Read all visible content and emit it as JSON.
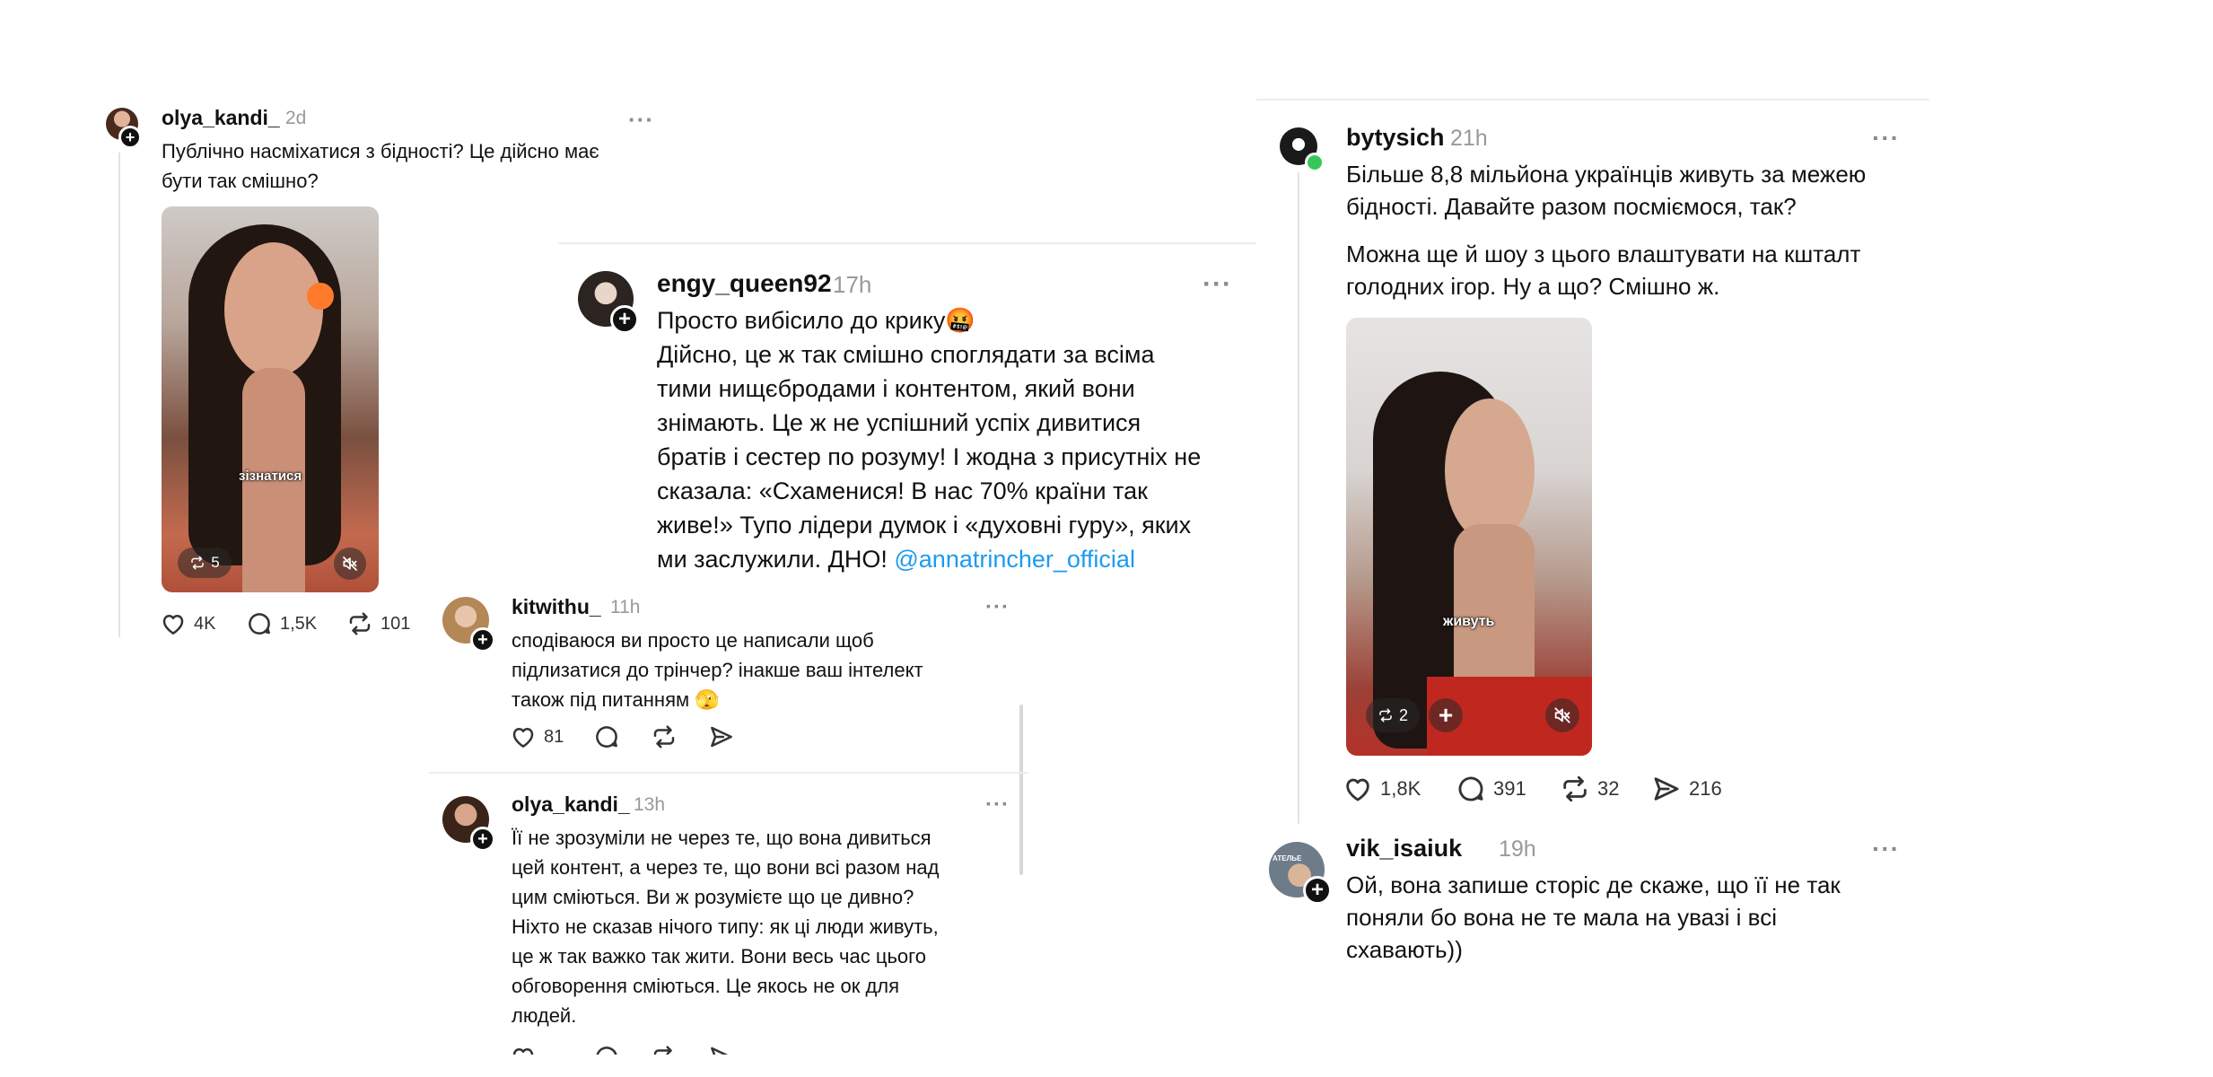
{
  "colors": {
    "text": "#111111",
    "muted": "#999999",
    "mention": "#1d9bf0",
    "online_dot": "#35c759",
    "divider": "#e6e6e6"
  },
  "icons": {
    "like": "heart-icon",
    "comment": "comment-bubble-icon",
    "repost": "repost-icon",
    "share": "paper-plane-icon",
    "more": "more-dots-icon",
    "mute": "speaker-muted-icon",
    "follow": "plus-icon"
  },
  "post1": {
    "username": "olya_kandi_",
    "time": "2d",
    "text_lines": [
      "Публічно насміхатися з бідності? Це дійсно має",
      "бути так смішно?"
    ],
    "more": "···",
    "media": {
      "caption": "зізнатися",
      "repost_count": "5"
    },
    "actions": {
      "likes": "4K",
      "comments": "1,5K",
      "reposts": "101"
    }
  },
  "post2": {
    "username": "engy_queen92",
    "time": "17h",
    "more": "···",
    "text_lines": [
      "Просто вибісило до крику🤬",
      "Дійсно, це ж так смішно споглядати за всіма",
      "тими нищєбродами і контентом, який вони",
      "знімають. Це ж не успішний успіх дивитися",
      "братів і сестер по розуму! І жодна з присутніх не",
      "сказала: «Схаменися! В нас 70% країни так",
      "живе!» Тупо лідери думок і «духовні гуру», яких"
    ],
    "last_line_text": "ми заслужили. ДНО! ",
    "mention": "@annatrincher_official"
  },
  "reply1": {
    "username": "kitwithu_",
    "time": "11h",
    "more": "···",
    "text_lines": [
      "сподіваюся ви просто це написали щоб",
      "підлизатися до трінчер? інакше ваш інтелект",
      "також під питанням 🫣"
    ],
    "likes": "81"
  },
  "reply2": {
    "username": "olya_kandi_",
    "time": "13h",
    "more": "···",
    "text_lines": [
      "Її не зрозуміли не через те, що вона дивиться",
      "цей контент, а через те, що вони всі разом над",
      "цим сміються. Ви ж розумієте що це дивно?",
      "Ніхто не сказав нічого типу: як ці люди живуть,",
      "це ж так важко так жити. Вони весь час цього",
      "обговорення сміються. Це якось не ок для",
      "людей."
    ]
  },
  "post3": {
    "username": "bytysich",
    "time": "21h",
    "more": "···",
    "para1_lines": [
      "Більше 8,8 мільйона українців живуть за межею",
      "бідності. Давайте разом посміємося, так?"
    ],
    "para2_lines": [
      "Можна ще й шоу з цього влаштувати на кшталт",
      "голодних ігор. Ну а що? Смішно ж."
    ],
    "media": {
      "caption": "живуть",
      "repost_count": "2"
    },
    "actions": {
      "likes": "1,8K",
      "comments": "391",
      "reposts": "32",
      "shares": "216"
    }
  },
  "post4": {
    "username": "vik_isaiuk",
    "time": "19h",
    "more": "···",
    "avatar_text": "АТЕЛЬЕ",
    "text_lines": [
      "Ой, вона запише сторіс де скаже, що її не так",
      "поняли бо вона не те мала на увазі і всі",
      "схавають))"
    ]
  }
}
